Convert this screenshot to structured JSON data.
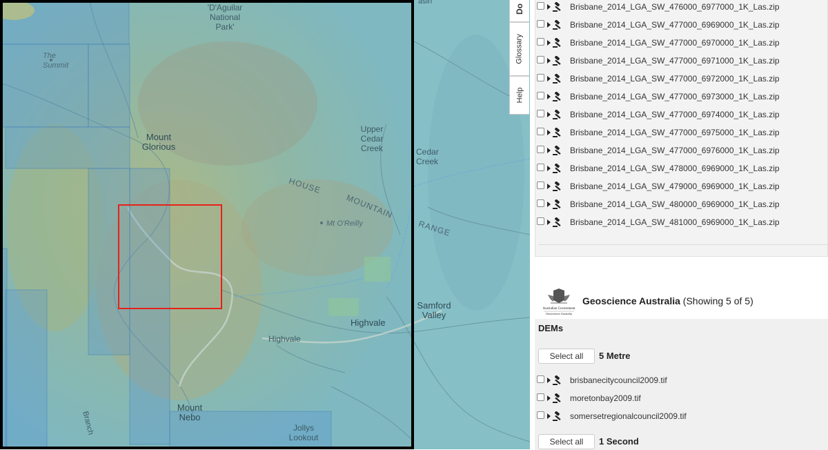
{
  "map": {
    "labels": {
      "daguilar": "'D'Aguilar\nNational\nPark'",
      "the_summit": "The\nSummit",
      "mount_glorious": "Mount\nGlorious",
      "upper_cedar_creek": "Upper\nCedar\nCreek",
      "cedar_creek": "Cedar\nCreek",
      "house": "HOUSE",
      "mountain": "MOUNTAIN",
      "range": "RANGE",
      "mt_oreilly": "Mt O'Reilly",
      "samford_valley": "Samford\nValley",
      "highvale_1": "Highvale",
      "highvale_2": "Highvale",
      "mount_nebo": "Mount\nNebo",
      "jollys_lookout": "Jollys\nLookout",
      "branch": "Branch",
      "basin_partial": "asin"
    }
  },
  "side_tabs": {
    "downloads": "Do",
    "glossary": "Glossary",
    "help": "Help"
  },
  "files": [
    "Brisbane_2014_LGA_SW_476000_6977000_1K_Las.zip",
    "Brisbane_2014_LGA_SW_477000_6969000_1K_Las.zip",
    "Brisbane_2014_LGA_SW_477000_6970000_1K_Las.zip",
    "Brisbane_2014_LGA_SW_477000_6971000_1K_Las.zip",
    "Brisbane_2014_LGA_SW_477000_6972000_1K_Las.zip",
    "Brisbane_2014_LGA_SW_477000_6973000_1K_Las.zip",
    "Brisbane_2014_LGA_SW_477000_6974000_1K_Las.zip",
    "Brisbane_2014_LGA_SW_477000_6975000_1K_Las.zip",
    "Brisbane_2014_LGA_SW_477000_6976000_1K_Las.zip",
    "Brisbane_2014_LGA_SW_478000_6969000_1K_Las.zip",
    "Brisbane_2014_LGA_SW_479000_6969000_1K_Las.zip",
    "Brisbane_2014_LGA_SW_480000_6969000_1K_Las.zip",
    "Brisbane_2014_LGA_SW_481000_6969000_1K_Las.zip"
  ],
  "provider": {
    "name": "Geoscience Australia",
    "showing": "(Showing 5 of 5)",
    "logo_line1": "Australian Government",
    "logo_line2": "Geoscience Australia",
    "category": "DEMs",
    "groups": [
      {
        "select_all_label": "Select all",
        "title": "5 Metre",
        "files": [
          "brisbanecitycouncil2009.tif",
          "moretonbay2009.tif",
          "somersetregionalcouncil2009.tif"
        ]
      },
      {
        "select_all_label": "Select all",
        "title": "1 Second"
      }
    ]
  },
  "colors": {
    "selection_outline": "#000000",
    "highlight_outline": "#e8201a",
    "coverage_fill": "#4e8fd6"
  }
}
